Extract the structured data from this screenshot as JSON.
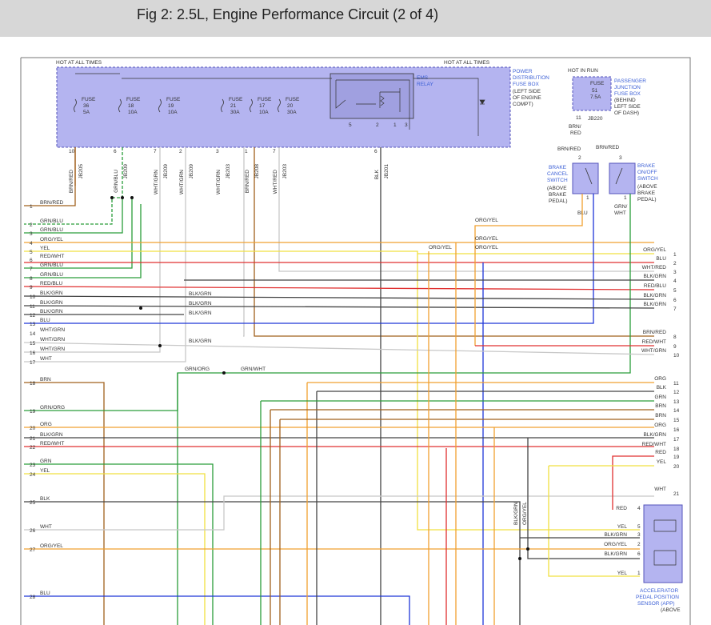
{
  "title": "Fig 2: 2.5L, Engine Performance Circuit (2 of 4)",
  "colors": {
    "box": "#b4b4f0",
    "box_stroke": "#5555bb",
    "blue_text": "#3b5fd6"
  },
  "top": {
    "hot_left": "HOT AT ALL TIMES",
    "hot_right": "HOT AT ALL TIMES",
    "hot_in_run": "HOT IN RUN",
    "pdc": [
      "POWER",
      "DISTRIBUTION",
      "FUSE BOX",
      "(LEFT SIDE",
      "OF ENGINE",
      "COMPT)"
    ],
    "pjb": [
      "PASSENGER",
      "JUNCTION",
      "FUSE BOX",
      "(BEHIND",
      "LEFT SIDE",
      "OF DASH)"
    ],
    "ems": [
      "EMS",
      "RELAY"
    ],
    "fuse51": [
      "FUSE",
      "51",
      "7.5A"
    ],
    "jb220": "JB220",
    "jb220_pin": "11",
    "fuses": [
      {
        "l": "FUSE",
        "n": "36",
        "a": "5A",
        "pin": "10",
        "jb": "JB205",
        "wire": "BRN/RED"
      },
      {
        "l": "FUSE",
        "n": "18",
        "a": "10A",
        "pin": "6",
        "jb": "JB209",
        "wire": "GRN/BLU"
      },
      {
        "l": "FUSE",
        "n": "19",
        "a": "10A",
        "pin": "7",
        "jb": "JB209",
        "wire": "WHT/GRN"
      },
      {
        "l": "",
        "n": "",
        "a": "",
        "pin": "2",
        "jb": "JB209",
        "wire": "WHT/GRN"
      },
      {
        "l": "FUSE",
        "n": "21",
        "a": "30A",
        "pin": "3",
        "jb": "JB203",
        "wire": "WHT/GRN"
      },
      {
        "l": "FUSE",
        "n": "17",
        "a": "10A",
        "pin": "1",
        "jb": "JB208",
        "wire": "BRN/RED"
      },
      {
        "l": "FUSE",
        "n": "20",
        "a": "30A",
        "pin": "7",
        "jb": "JB203",
        "wire": "WHT/RED"
      },
      {
        "l": "",
        "n": "",
        "a": "",
        "pin": "6",
        "jb": "JB201",
        "wire": "BLK"
      }
    ],
    "relay_pins": [
      "5",
      "2",
      "1",
      "3"
    ]
  },
  "brake": {
    "brn_red_a": "BRN/",
    "brn_red_b": "RED",
    "brn_red1": "BRN/RED",
    "brn_red2": "BRN/RED",
    "cancel": [
      "BRAKE",
      "CANCEL",
      "SWITCH",
      "(ABOVE",
      "BRAKE",
      "PEDAL)"
    ],
    "onoff": [
      "BRAKE",
      "ON/OFF",
      "SWITCH",
      "(ABOVE",
      "BRAKE",
      "PEDAL)"
    ],
    "pins": [
      "2",
      "1",
      "3",
      "1"
    ],
    "blu": "BLU",
    "grn_wht_a": "GRN/",
    "grn_wht_b": "WHT"
  },
  "left_rows": [
    {
      "n": "1",
      "w": "BRN/RED"
    },
    {
      "n": "2",
      "w": "GRN/BLU"
    },
    {
      "n": "3",
      "w": "GRN/BLU"
    },
    {
      "n": "4",
      "w": "ORG/YEL"
    },
    {
      "n": "5",
      "w": "YEL"
    },
    {
      "n": "6",
      "w": "RED/WHT"
    },
    {
      "n": "7",
      "w": "GRN/BLU"
    },
    {
      "n": "8",
      "w": "GRN/BLU"
    },
    {
      "n": "9",
      "w": "RED/BLU"
    },
    {
      "n": "10",
      "w": "BLK/GRN"
    },
    {
      "n": "11",
      "w": "BLK/GRN"
    },
    {
      "n": "12",
      "w": "BLK/GRN"
    },
    {
      "n": "13",
      "w": "BLU"
    },
    {
      "n": "14",
      "w": "WHT/GRN"
    },
    {
      "n": "15",
      "w": "WHT/GRN"
    },
    {
      "n": "16",
      "w": "WHT/GRN"
    },
    {
      "n": "17",
      "w": "WHT"
    },
    {
      "n": "18",
      "w": "BRN"
    },
    {
      "n": "19",
      "w": "GRN/ORG"
    },
    {
      "n": "20",
      "w": "ORG"
    },
    {
      "n": "21",
      "w": "BLK/GRN"
    },
    {
      "n": "22",
      "w": "RED/WHT"
    },
    {
      "n": "23",
      "w": "GRN"
    },
    {
      "n": "24",
      "w": "YEL"
    },
    {
      "n": "25",
      "w": "BLK"
    },
    {
      "n": "26",
      "w": "WHT"
    },
    {
      "n": "27",
      "w": "ORG/YEL"
    },
    {
      "n": "28",
      "w": "BLU"
    }
  ],
  "right_rows": [
    {
      "n": "1",
      "w": "ORG/YEL"
    },
    {
      "n": "2",
      "w": "BLU"
    },
    {
      "n": "3",
      "w": "WHT/RED"
    },
    {
      "n": "4",
      "w": "BLK/GRN"
    },
    {
      "n": "5",
      "w": "RED/BLU"
    },
    {
      "n": "6",
      "w": "BLK/GRN"
    },
    {
      "n": "7",
      "w": "BLK/GRN"
    },
    {
      "n": "8",
      "w": "BRN/RED"
    },
    {
      "n": "9",
      "w": "RED/WHT"
    },
    {
      "n": "10",
      "w": "WHT/GRN"
    },
    {
      "n": "11",
      "w": "ORG"
    },
    {
      "n": "12",
      "w": "BLK"
    },
    {
      "n": "13",
      "w": "GRN"
    },
    {
      "n": "14",
      "w": "BRN"
    },
    {
      "n": "15",
      "w": "BRN"
    },
    {
      "n": "16",
      "w": "ORG"
    },
    {
      "n": "17",
      "w": "BLK/GRN"
    },
    {
      "n": "18",
      "w": "RED/WHT"
    },
    {
      "n": "19",
      "w": "RED"
    },
    {
      "n": "20",
      "w": "YEL"
    },
    {
      "n": "21",
      "w": "WHT"
    }
  ],
  "mid": {
    "blkgrn1": "BLK/GRN",
    "blkgrn2": "BLK/GRN",
    "blkgrn3": "BLK/GRN",
    "blkgrn4": "BLK/GRN",
    "grnorg": "GRN/ORG",
    "grnwht": "GRN/WHT",
    "orgyel1": "ORG/YEL",
    "orgyel2": "ORG/YEL",
    "orgyel3": "ORG/YEL",
    "orgyel4": "ORG/YEL",
    "vblkgrn": "BLK/GRN",
    "vorgyel": "ORG/YEL"
  },
  "app": {
    "pins": [
      {
        "n": "4",
        "w": "RED"
      },
      {
        "n": "5",
        "w": "YEL"
      },
      {
        "n": "3",
        "w": "BLK/GRN"
      },
      {
        "n": "2",
        "w": "ORG/YEL"
      },
      {
        "n": "6",
        "w": "BLK/GRN"
      },
      {
        "n": "1",
        "w": "YEL"
      }
    ],
    "label": [
      "ACCELERATOR",
      "PEDAL POSITION",
      "SENSOR (APP)",
      "(ABOVE"
    ]
  }
}
